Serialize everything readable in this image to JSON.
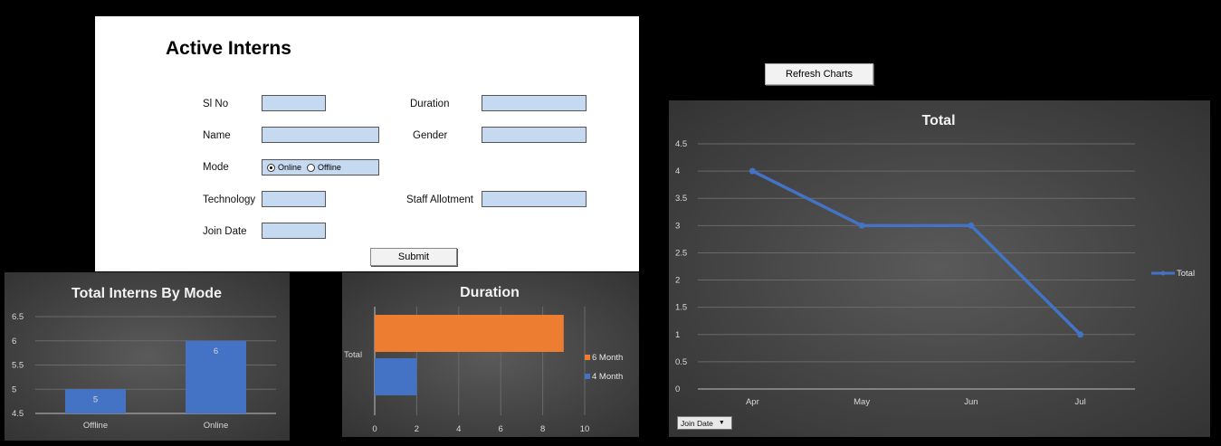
{
  "form": {
    "title": "Active Interns",
    "labels": {
      "sl_no": "Sl No",
      "name": "Name",
      "mode": "Mode",
      "technology": "Technology",
      "join_date": "Join Date",
      "duration": "Duration",
      "gender": "Gender",
      "staff_allotment": "Staff Allotment"
    },
    "values": {
      "sl_no": "",
      "name": "",
      "technology": "",
      "join_date": "",
      "duration": "",
      "gender": "",
      "staff_allotment": ""
    },
    "mode_options": [
      "Online",
      "Offline"
    ],
    "mode_selected": "Online",
    "submit_label": "Submit",
    "field_color": "#c5d9f1"
  },
  "refresh_label": "Refresh Charts",
  "chart_data": [
    {
      "id": "mode",
      "type": "bar",
      "title": "Total Interns By Mode",
      "categories": [
        "Offline",
        "Online"
      ],
      "values": [
        5,
        6
      ],
      "data_labels": [
        "5",
        "6"
      ],
      "yticks": [
        "4.5",
        "5",
        "5.5",
        "6",
        "6.5"
      ],
      "ylim": [
        4.5,
        6.5
      ],
      "grid": true,
      "bar_color": "#4472c4"
    },
    {
      "id": "duration",
      "type": "bar",
      "orientation": "horizontal",
      "title": "Duration",
      "categories": [
        "Total"
      ],
      "series": [
        {
          "name": "6 Month",
          "values": [
            9
          ],
          "color": "#ed7d31"
        },
        {
          "name": "4 Month",
          "values": [
            2
          ],
          "color": "#4472c4"
        }
      ],
      "xticks": [
        "0",
        "2",
        "4",
        "6",
        "8",
        "10"
      ],
      "xlim": [
        0,
        10
      ],
      "legend": "right",
      "grid": true
    },
    {
      "id": "total",
      "type": "line",
      "title": "Total",
      "categories": [
        "Apr",
        "May",
        "Jun",
        "Jul"
      ],
      "series": [
        {
          "name": "Total",
          "values": [
            4,
            3,
            3,
            1
          ],
          "color": "#4472c4"
        }
      ],
      "yticks": [
        "0",
        "0.5",
        "1",
        "1.5",
        "2",
        "2.5",
        "3",
        "3.5",
        "4",
        "4.5"
      ],
      "ylim": [
        0,
        4.5
      ],
      "legend": "right",
      "grid": true,
      "filter_button": "Join Date"
    }
  ]
}
